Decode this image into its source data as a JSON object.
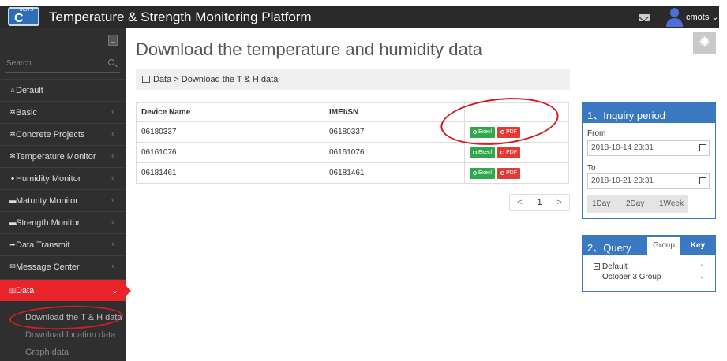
{
  "header": {
    "logo_small": "MOTS",
    "logo_letter": "C",
    "app_title": "Temperature & Strength Monitoring Platform",
    "username": "cmots ⌄"
  },
  "sidebar": {
    "search_placeholder": "Search...",
    "items": [
      {
        "label": "Default",
        "icon": "home-icon",
        "chevron": ""
      },
      {
        "label": "Basic",
        "icon": "gears-icon",
        "chevron": "‹"
      },
      {
        "label": "Concrete Projects",
        "icon": "gears-icon",
        "chevron": "‹"
      },
      {
        "label": "Temperature Monitor",
        "icon": "cogs-icon",
        "chevron": "‹"
      },
      {
        "label": "Humidity Monitor",
        "icon": "drop-icon",
        "chevron": "‹"
      },
      {
        "label": "Maturity Monitor",
        "icon": "monitor-icon",
        "chevron": "‹"
      },
      {
        "label": "Strength Monitor",
        "icon": "monitor-icon",
        "chevron": "‹"
      },
      {
        "label": "Data Transmit",
        "icon": "share-icon",
        "chevron": "‹"
      },
      {
        "label": "Message Center",
        "icon": "envelope-icon",
        "chevron": "‹"
      },
      {
        "label": "Data",
        "icon": "bar-chart-icon",
        "chevron": "⌄"
      }
    ],
    "sub_items": [
      "Download the T & H data",
      "Download location data",
      "Graph data"
    ]
  },
  "main": {
    "title": "Download the temperature and humidity data",
    "breadcrumb": "Data > Download the T & H data",
    "table": {
      "columns": [
        "Device Name",
        "IMEI/SN",
        ""
      ],
      "rows": [
        {
          "device": "06180337",
          "imei": "06180337"
        },
        {
          "device": "06161076",
          "imei": "06161076"
        },
        {
          "device": "06181461",
          "imei": "06181461"
        }
      ],
      "excel_label": "Execl",
      "pdf_label": "PDF"
    },
    "pagination": {
      "prev": "<",
      "current": "1",
      "next": ">"
    }
  },
  "inquiry": {
    "title": "1、Inquiry period",
    "from_label": "From",
    "from_value": "2018-10-14 23:31",
    "to_label": "To",
    "to_value": "2018-10-21 23:31",
    "ranges": [
      "1Day",
      "2Day",
      "1Week"
    ]
  },
  "query": {
    "title": "2、Query",
    "tab_group": "Group",
    "tab_key": "Key",
    "tree_root": "Default",
    "tree_child": "October 3 Group"
  },
  "colors": {
    "accent": "#3a78c2",
    "active_nav": "#e8232a",
    "excel": "#2ea84b",
    "pdf": "#e23b35",
    "annotation_circle": "#d41c24"
  }
}
